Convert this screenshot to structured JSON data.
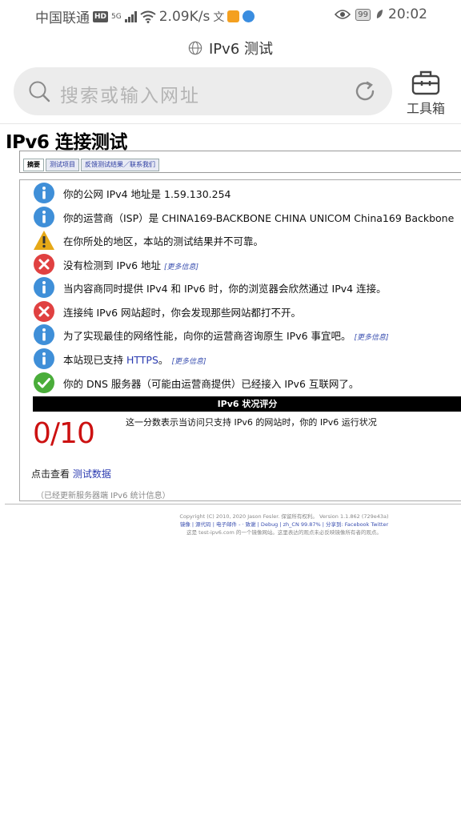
{
  "status_bar": {
    "carrier": "中国联通",
    "hd": "HD",
    "signal": "5G",
    "speed": "2.09K/s",
    "battery": "99",
    "time": "20:02"
  },
  "top_bar": {
    "title": "IPv6 测试"
  },
  "search": {
    "placeholder": "搜索或输入网址"
  },
  "toolbox": {
    "label": "工具箱"
  },
  "page": {
    "title": "IPv6 连接测试",
    "tabs": [
      "摘要",
      "测试项目",
      "反馈测试结果／联系我们"
    ],
    "results": [
      {
        "icon": "info",
        "text": "你的公网 IPv4 地址是 1.59.130.254"
      },
      {
        "icon": "info",
        "text": "你的运营商（ISP）是 CHINA169-BACKBONE CHINA UNICOM China169 Backbone"
      },
      {
        "icon": "warning",
        "text": "在你所处的地区，本站的测试结果并不可靠。"
      },
      {
        "icon": "error",
        "text": "没有检测到 IPv6 地址",
        "more": "[更多信息]"
      },
      {
        "icon": "info",
        "text": "当内容商同时提供 IPv4 和 IPv6 时，你的浏览器会欣然通过 IPv4 连接。"
      },
      {
        "icon": "error",
        "text": "连接纯 IPv6 网站超时，你会发现那些网站都打不开。"
      },
      {
        "icon": "info",
        "text": "为了实现最佳的网络性能，向你的运营商咨询原生 IPv6 事宜吧。",
        "more": "[更多信息]"
      },
      {
        "icon": "info",
        "text_pre": "本站现已支持 ",
        "link": "HTTPS",
        "text_post": "。",
        "more": "[更多信息]"
      },
      {
        "icon": "ok",
        "text": "你的 DNS 服务器（可能由运营商提供）已经接入 IPv6 互联网了。"
      }
    ],
    "score_header": "IPv6 状况评分",
    "score": "0/10",
    "score_desc": "这一分数表示当访问只支持 IPv6 的网站时，你的 IPv6 运行状况",
    "click_view_pre": "点击查看 ",
    "click_view_link": "测试数据",
    "caveat": "（已经更新服务器端 IPv6 统计信息）"
  },
  "footer": {
    "line1": "Copyright (C) 2010, 2020 Jason Fesler. 保留所有权利。 Version 1.1.862 (729e43a)",
    "line2_links": "镜像 | 源代码 | 电子邮件 - · 致谢 | Debug | zh_CN 99.87% | 分享到: Facebook Twitter",
    "line3": "这是 test-ipv6.com 的一个镜像网站。这里表达的观点未必反映镜像所有者的观点。"
  },
  "colors": {
    "info": "#3f8fd8",
    "warning": "#e6a817",
    "error": "#e04141",
    "ok": "#4aad3a",
    "score": "#cc1111"
  }
}
